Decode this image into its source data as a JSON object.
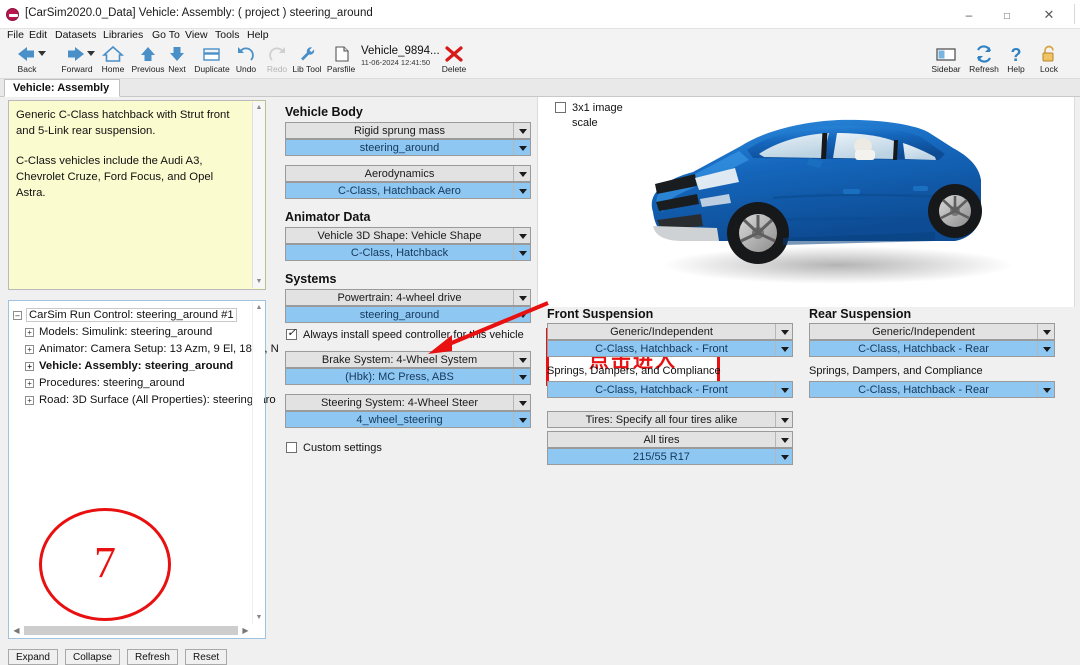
{
  "window": {
    "title": "[CarSim2020.0_Data] Vehicle: Assembly: ( project ) steering_around",
    "minimize": "–",
    "maximize": "□",
    "close": "✕"
  },
  "menubar": {
    "items": [
      {
        "label": "File"
      },
      {
        "label": "Edit"
      },
      {
        "label": "Datasets"
      },
      {
        "label": "Libraries"
      },
      {
        "label": "Go To"
      },
      {
        "label": "View"
      },
      {
        "label": "Tools"
      },
      {
        "label": "Help"
      }
    ]
  },
  "toolbar": {
    "items": [
      {
        "label": "Back",
        "icon": "arrow-left-icon",
        "dropdown": true
      },
      {
        "label": "Forward",
        "icon": "arrow-right-icon",
        "dropdown": true
      },
      {
        "label": "Home",
        "icon": "home-icon",
        "dropdown": false
      },
      {
        "label": "Previous",
        "icon": "arrow-up-icon",
        "dropdown": false
      },
      {
        "label": "Next",
        "icon": "arrow-down-icon",
        "dropdown": false
      },
      {
        "label": "Duplicate",
        "icon": "duplicate-icon",
        "dropdown": false
      },
      {
        "label": "Undo",
        "icon": "undo-icon",
        "dropdown": false
      },
      {
        "label": "Redo",
        "icon": "redo-icon",
        "dropdown": false,
        "disabled": true
      },
      {
        "label": "Lib Tool",
        "icon": "wrench-icon",
        "dropdown": false
      },
      {
        "label": "Parsfile",
        "icon": "document-icon",
        "dropdown": false
      }
    ],
    "parsfile": {
      "name": "Vehicle_9894...",
      "timestamp": "11-06-2024 12:41:50"
    },
    "delete": {
      "label": "Delete",
      "icon": "red-x-icon"
    },
    "right_items": [
      {
        "label": "Sidebar",
        "icon": "sidebar-icon"
      },
      {
        "label": "Refresh",
        "icon": "refresh-icon"
      },
      {
        "label": "Help",
        "icon": "question-mark-icon"
      },
      {
        "label": "Lock",
        "icon": "padlock-icon"
      }
    ]
  },
  "tab": {
    "label": "Vehicle: Assembly"
  },
  "notes": {
    "paragraphs": [
      "Generic C-Class hatchback with Strut front and 5-Link rear suspension.",
      "C-Class vehicles include the Audi A3, Chevrolet Cruze, Ford Focus, and Opel Astra."
    ]
  },
  "tree": {
    "nodes": [
      {
        "label": "CarSim Run Control: steering_around #1",
        "bold": false,
        "root": true
      },
      {
        "label": "Models: Simulink: steering_around",
        "bold": false,
        "root": false
      },
      {
        "label": "Animator: Camera Setup: 13 Azm, 9 El, 18 m, N",
        "bold": false,
        "root": false
      },
      {
        "label": "Vehicle: Assembly: steering_around",
        "bold": true,
        "root": false
      },
      {
        "label": "Procedures: steering_around",
        "bold": false,
        "root": false
      },
      {
        "label": "Road: 3D Surface (All Properties): steering_aro",
        "bold": false,
        "root": false
      }
    ]
  },
  "tree_buttons": [
    {
      "label": "Expand"
    },
    {
      "label": "Collapse"
    },
    {
      "label": "Refresh"
    },
    {
      "label": "Reset"
    }
  ],
  "vehicle_body": {
    "heading": "Vehicle Body",
    "rows": [
      {
        "category": "Rigid sprung mass",
        "dataset": "steering_around"
      },
      {
        "category": "Aerodynamics",
        "dataset": "C-Class, Hatchback Aero"
      }
    ]
  },
  "animator_data": {
    "heading": "Animator Data",
    "rows": [
      {
        "category": "Vehicle 3D Shape: Vehicle Shape",
        "dataset": "C-Class, Hatchback"
      }
    ]
  },
  "systems": {
    "heading": "Systems",
    "powertrain": {
      "category": "Powertrain: 4-wheel drive",
      "dataset": "steering_around"
    },
    "speed_controller_checkbox": {
      "label": "Always install speed controller for this vehicle",
      "checked": true
    },
    "brake": {
      "category": "Brake System: 4-Wheel System",
      "dataset": "(Hbk): MC Press, ABS"
    },
    "steering": {
      "category": "Steering System: 4-Wheel Steer",
      "dataset": "4_wheel_steering"
    },
    "custom_settings_checkbox": {
      "label": "Custom settings",
      "checked": false
    }
  },
  "front_suspension": {
    "heading": "Front Suspension",
    "kinematics": {
      "category": "Generic/Independent",
      "dataset": "C-Class, Hatchback - Front"
    },
    "springs_label": "Springs, Dampers, and Compliance",
    "springs": {
      "dataset": "C-Class, Hatchback - Front"
    }
  },
  "rear_suspension": {
    "heading": "Rear Suspension",
    "kinematics": {
      "category": "Generic/Independent",
      "dataset": "C-Class, Hatchback - Rear"
    },
    "springs_label": "Springs, Dampers, and Compliance",
    "springs": {
      "dataset": "C-Class, Hatchback - Rear"
    }
  },
  "tires": {
    "mode": "Tires: Specify all four tires alike",
    "category": "All tires",
    "dataset": "215/55 R17"
  },
  "image_pane": {
    "checkbox": {
      "label_line1": "3x1 image",
      "label_line2": "scale",
      "checked": false
    },
    "picture": "blue-hatchback-3d-render"
  },
  "annotations": {
    "callout_text": "点击进入",
    "step_number": "7",
    "accent_color": "#e81010"
  }
}
